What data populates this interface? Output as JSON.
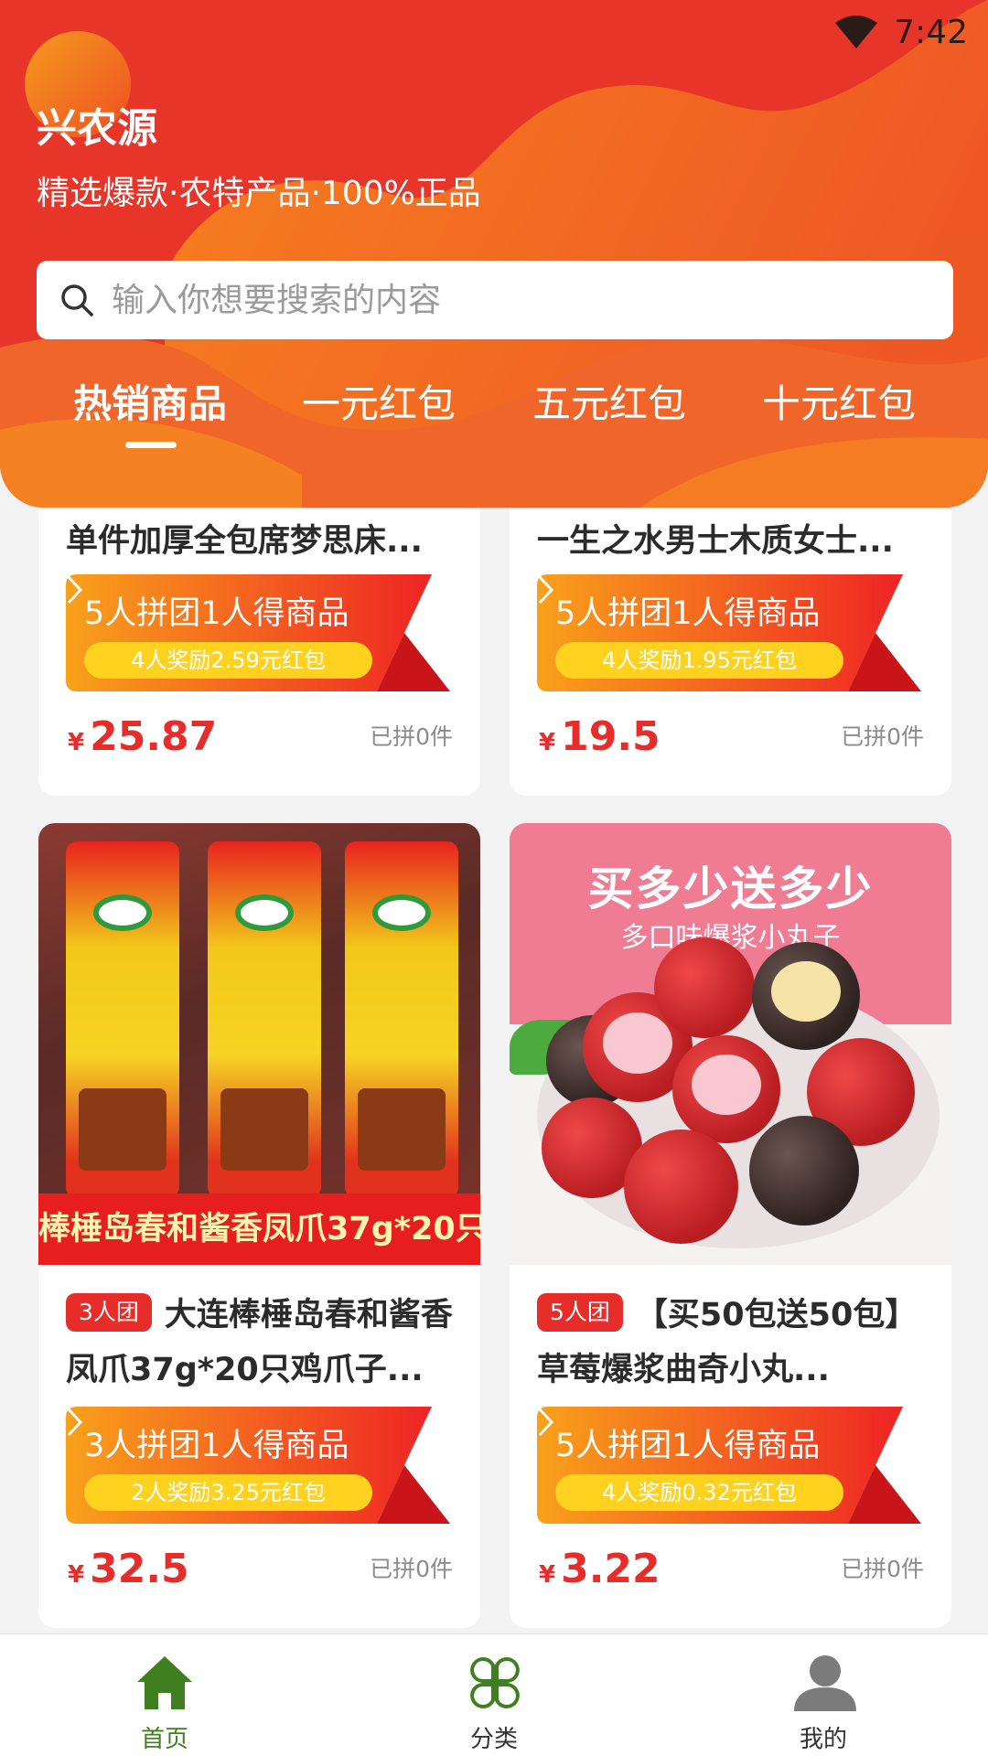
{
  "status_bar": {
    "time": "7:42"
  },
  "header": {
    "title": "兴农源",
    "slogan": "精选爆款·农特产品·100%正品",
    "search_placeholder": "输入你想要搜索的内容",
    "colors": {
      "primary": "#e8352a",
      "accent": "#f7841f"
    }
  },
  "tabs": [
    {
      "label": "热销商品",
      "active": true
    },
    {
      "label": "一元红包",
      "active": false
    },
    {
      "label": "五元红包",
      "active": false
    },
    {
      "label": "十元红包",
      "active": false
    }
  ],
  "products": [
    {
      "title": "单件加厚全包席梦思床...",
      "group_title": "5人拼团1人得商品",
      "reward": "4人奖励2.59元红包",
      "currency": "¥",
      "price": "25.87",
      "sold": "已拼0件"
    },
    {
      "title": "一生之水男士木质女士...",
      "group_title": "5人拼团1人得商品",
      "reward": "4人奖励1.95元红包",
      "currency": "¥",
      "price": "19.5",
      "sold": "已拼0件"
    },
    {
      "image_caption": "棒棰岛春和酱香凤爪37g*20只",
      "badge": "3人团",
      "title": "大连棒棰岛春和酱香凤爪37g*20只鸡爪子...",
      "group_title": "3人拼团1人得商品",
      "reward": "2人奖励3.25元红包",
      "currency": "¥",
      "price": "32.5",
      "sold": "已拼0件"
    },
    {
      "image_headline": "买多少送多少",
      "image_subline": "多口味爆浆小丸子",
      "badge": "5人团",
      "title": "【买50包送50包】草莓爆浆曲奇小丸...",
      "group_title": "5人拼团1人得商品",
      "reward": "4人奖励0.32元红包",
      "currency": "¥",
      "price": "3.22",
      "sold": "已拼0件"
    }
  ],
  "bottom_nav": [
    {
      "label": "首页",
      "icon": "home-icon",
      "active": true
    },
    {
      "label": "分类",
      "icon": "category-icon",
      "active": false
    },
    {
      "label": "我的",
      "icon": "profile-icon",
      "active": false
    }
  ],
  "theme": {
    "price_red": "#e62d2a",
    "nav_green": "#3f7f1f",
    "reward_yellow": "#ffd21f"
  }
}
